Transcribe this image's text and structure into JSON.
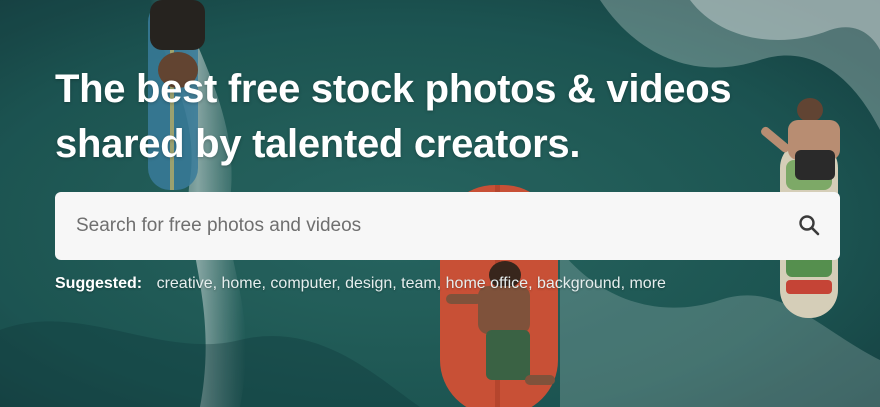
{
  "hero": {
    "headline_line1": "The best free stock photos & videos",
    "headline_line2": "shared by talented creators."
  },
  "search": {
    "placeholder": "Search for free photos and videos",
    "value": "",
    "icon": "search-icon"
  },
  "suggested": {
    "label": "Suggested:",
    "tags": [
      "creative",
      "home",
      "computer",
      "design",
      "team",
      "home office",
      "background",
      "more"
    ]
  },
  "colors": {
    "ocean": "#1d5a58",
    "text": "#ffffff",
    "search_bg": "#f7f7f7"
  }
}
